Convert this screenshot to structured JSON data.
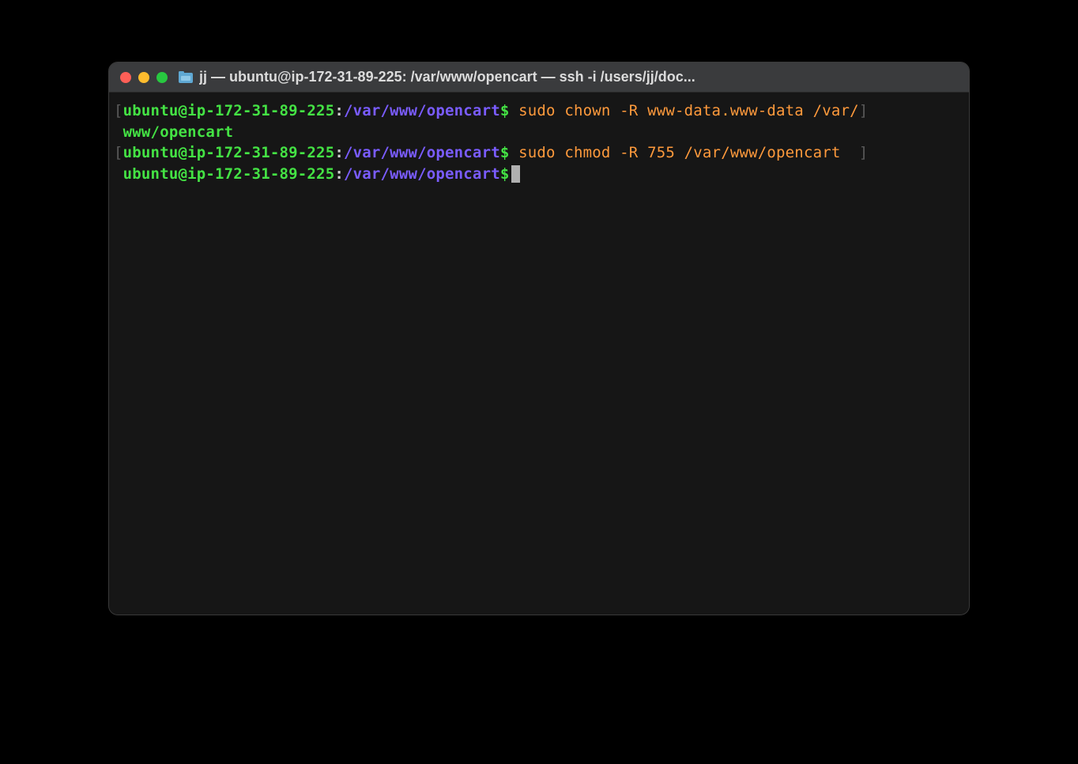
{
  "window": {
    "title": "jj — ubuntu@ip-172-31-89-225: /var/www/opencart — ssh -i /users/jj/doc..."
  },
  "prompt": {
    "user_host": "ubuntu@ip-172-31-89-225",
    "separator": ":",
    "path": "/var/www/opencart",
    "symbol": "$",
    "open_bracket": "[",
    "close_bracket": "]"
  },
  "lines": [
    {
      "command": "sudo chown -R www-data.www-data /var/",
      "wrap": "www/opencart"
    },
    {
      "command": "sudo chmod -R 755 /var/www/opencart  "
    }
  ]
}
